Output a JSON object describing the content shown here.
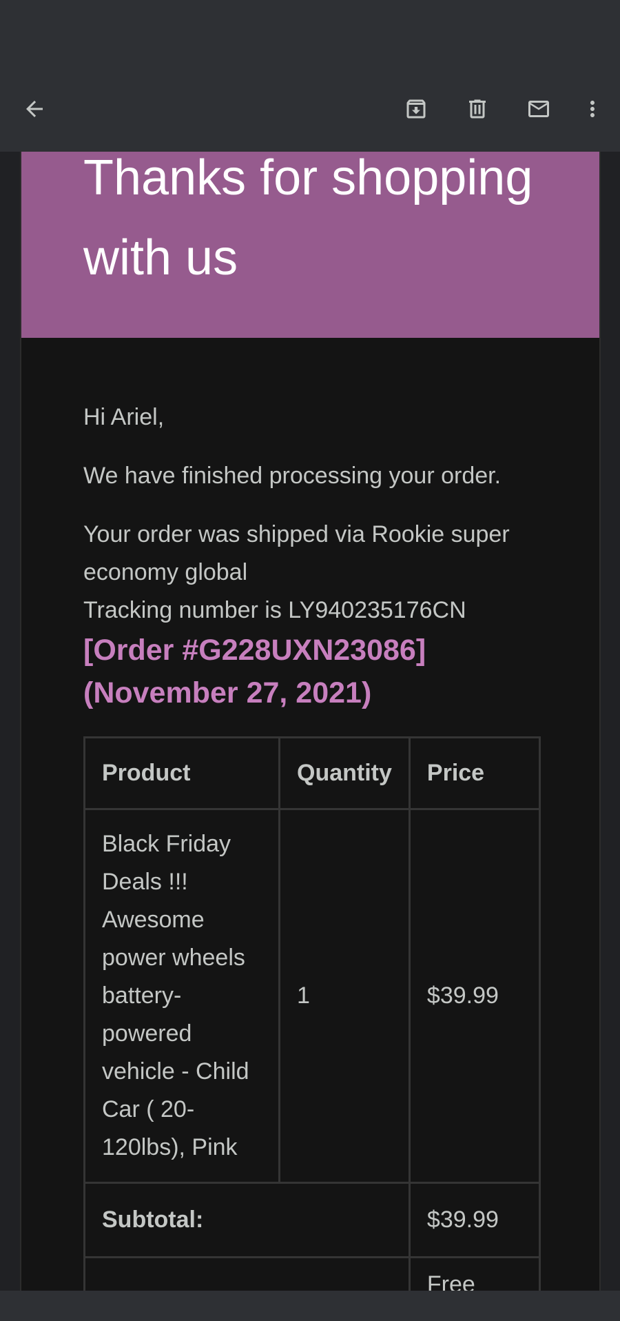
{
  "toolbar": {
    "back": "arrow-back-icon",
    "archive": "archive-icon",
    "delete": "delete-icon",
    "mark_unread": "mail-icon",
    "more": "more-vert-icon"
  },
  "email": {
    "hero_title": "Thanks for shopping with us",
    "greeting": "Hi Ariel,",
    "line1": "We have finished processing your order.",
    "line2": "Your order was shipped via Rookie super economy global",
    "line3": "Tracking number is LY940235176CN",
    "order_title": "[Order #G228UXN23086] (November 27, 2021)",
    "table": {
      "headers": [
        "Product",
        "Quantity",
        "Price"
      ],
      "rows": [
        {
          "product": "Black Friday Deals !!! Awesome power wheels battery-powered vehicle - Child Car ( 20-120lbs), Pink",
          "quantity": "1",
          "price": "$39.99"
        }
      ],
      "subtotal_label": "Subtotal:",
      "subtotal_value": "$39.99",
      "shipping_value": "Free"
    }
  },
  "colors": {
    "accent": "#c77fbe",
    "hero_bg": "#965b8e"
  }
}
